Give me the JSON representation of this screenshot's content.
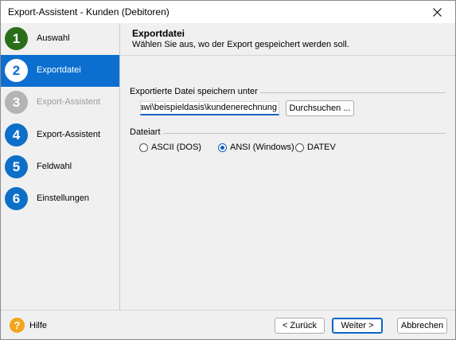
{
  "window": {
    "title": "Export-Assistent - Kunden (Debitoren)"
  },
  "sidebar": {
    "items": [
      {
        "number": "1",
        "label": "Auswahl"
      },
      {
        "number": "2",
        "label": "Exportdatei"
      },
      {
        "number": "3",
        "label": "Export-Assistent"
      },
      {
        "number": "4",
        "label": "Export-Assistent"
      },
      {
        "number": "5",
        "label": "Feldwahl"
      },
      {
        "number": "6",
        "label": "Einstellungen"
      }
    ]
  },
  "header": {
    "title": "Exportdatei",
    "subtitle": "Wählen Sie aus, wo der Export gespeichert werden soll."
  },
  "save_section": {
    "label": "Exportierte Datei speichern unter",
    "path_value": "...ts\\wawi\\beispieldasis\\kundenerechnung",
    "browse_label": "Durchsuchen ..."
  },
  "filetype_section": {
    "label": "Dateiart",
    "options": [
      {
        "label": "ASCII (DOS)",
        "selected": false
      },
      {
        "label": "ANSI (Windows)",
        "selected": true
      },
      {
        "label": "DATEV",
        "selected": false
      }
    ]
  },
  "footer": {
    "help_icon": "question-mark-icon",
    "help_label": "Hilfe",
    "back_label": "< Zurück",
    "next_label": "Weiter >",
    "cancel_label": "Abbrechen"
  },
  "colors": {
    "active_step": "#0c6fd0",
    "step_done": "#2a6e1b",
    "step_pending": "#0e6fc9",
    "step_disabled": "#b4b4b4",
    "help": "#f2a51c"
  }
}
